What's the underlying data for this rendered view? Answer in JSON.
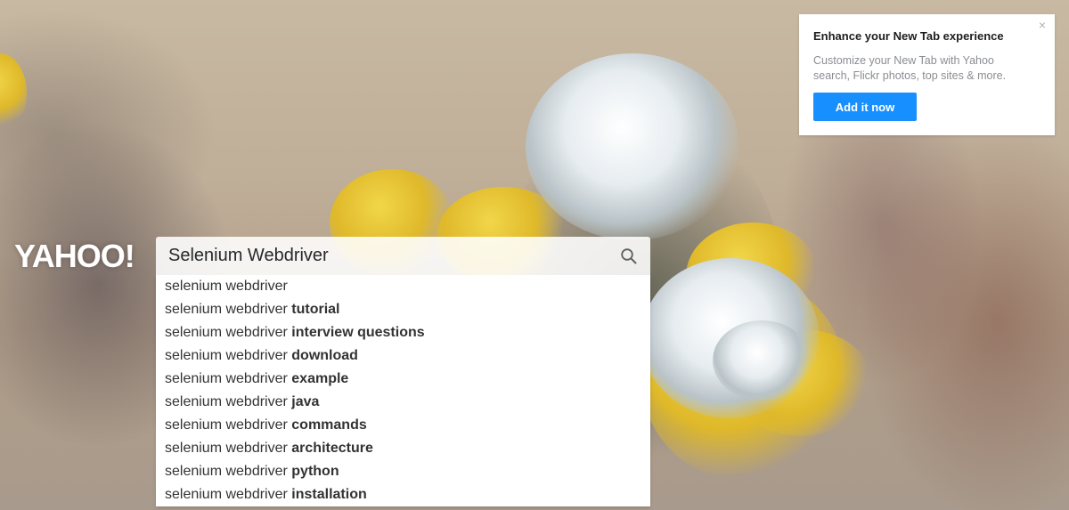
{
  "logo": {
    "text": "YAHOO!"
  },
  "search": {
    "value": "Selenium Webdriver",
    "icon": "search-icon",
    "suggestions": [
      {
        "base": "selenium webdriver",
        "bold": ""
      },
      {
        "base": "selenium webdriver ",
        "bold": "tutorial"
      },
      {
        "base": "selenium webdriver ",
        "bold": "interview questions"
      },
      {
        "base": "selenium webdriver ",
        "bold": "download"
      },
      {
        "base": "selenium webdriver ",
        "bold": "example"
      },
      {
        "base": "selenium webdriver ",
        "bold": "java"
      },
      {
        "base": "selenium webdriver ",
        "bold": "commands"
      },
      {
        "base": "selenium webdriver ",
        "bold": "architecture"
      },
      {
        "base": "selenium webdriver ",
        "bold": "python"
      },
      {
        "base": "selenium webdriver ",
        "bold": "installation"
      }
    ]
  },
  "promo": {
    "title": "Enhance your New Tab experience",
    "text": "Customize your New Tab with Yahoo search, Flickr photos, top sites & more.",
    "button_label": "Add it now",
    "close_label": "×",
    "button_color": "#188fff"
  },
  "background": {
    "description_icon": "lichen-photo"
  }
}
